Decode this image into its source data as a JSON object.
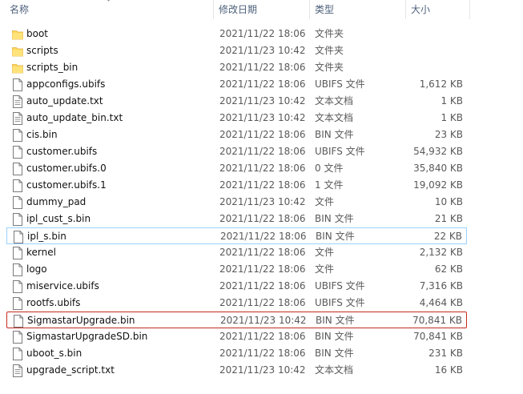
{
  "columns": {
    "name": "名称",
    "date": "修改日期",
    "type": "类型",
    "size": "大小"
  },
  "files": [
    {
      "name": "boot",
      "date": "2021/11/22 18:06",
      "type": "文件夹",
      "size": "",
      "icon": "folder-icon"
    },
    {
      "name": "scripts",
      "date": "2021/11/23 10:42",
      "type": "文件夹",
      "size": "",
      "icon": "folder-icon"
    },
    {
      "name": "scripts_bin",
      "date": "2021/11/22 18:06",
      "type": "文件夹",
      "size": "",
      "icon": "folder-icon"
    },
    {
      "name": "appconfigs.ubifs",
      "date": "2021/11/22 18:06",
      "type": "UBIFS 文件",
      "size": "1,612 KB",
      "icon": "file-icon"
    },
    {
      "name": "auto_update.txt",
      "date": "2021/11/23 10:42",
      "type": "文本文档",
      "size": "1 KB",
      "icon": "text-file-icon"
    },
    {
      "name": "auto_update_bin.txt",
      "date": "2021/11/23 10:42",
      "type": "文本文档",
      "size": "1 KB",
      "icon": "text-file-icon"
    },
    {
      "name": "cis.bin",
      "date": "2021/11/22 18:06",
      "type": "BIN 文件",
      "size": "23 KB",
      "icon": "file-icon"
    },
    {
      "name": "customer.ubifs",
      "date": "2021/11/22 18:06",
      "type": "UBIFS 文件",
      "size": "54,932 KB",
      "icon": "file-icon"
    },
    {
      "name": "customer.ubifs.0",
      "date": "2021/11/22 18:06",
      "type": "0 文件",
      "size": "35,840 KB",
      "icon": "file-icon"
    },
    {
      "name": "customer.ubifs.1",
      "date": "2021/11/22 18:06",
      "type": "1 文件",
      "size": "19,092 KB",
      "icon": "file-icon"
    },
    {
      "name": "dummy_pad",
      "date": "2021/11/23 10:42",
      "type": "文件",
      "size": "10 KB",
      "icon": "file-icon"
    },
    {
      "name": "ipl_cust_s.bin",
      "date": "2021/11/22 18:06",
      "type": "BIN 文件",
      "size": "21 KB",
      "icon": "file-icon"
    },
    {
      "name": "ipl_s.bin",
      "date": "2021/11/22 18:06",
      "type": "BIN 文件",
      "size": "22 KB",
      "icon": "file-icon",
      "focused": true
    },
    {
      "name": "kernel",
      "date": "2021/11/22 18:06",
      "type": "文件",
      "size": "2,132 KB",
      "icon": "file-icon"
    },
    {
      "name": "logo",
      "date": "2021/11/22 18:06",
      "type": "文件",
      "size": "62 KB",
      "icon": "file-icon"
    },
    {
      "name": "miservice.ubifs",
      "date": "2021/11/22 18:06",
      "type": "UBIFS 文件",
      "size": "7,316 KB",
      "icon": "file-icon"
    },
    {
      "name": "rootfs.ubifs",
      "date": "2021/11/22 18:06",
      "type": "UBIFS 文件",
      "size": "4,464 KB",
      "icon": "file-icon"
    },
    {
      "name": "SigmastarUpgrade.bin",
      "date": "2021/11/23 10:42",
      "type": "BIN 文件",
      "size": "70,841 KB",
      "icon": "file-icon",
      "marked": true
    },
    {
      "name": "SigmastarUpgradeSD.bin",
      "date": "2021/11/22 18:06",
      "type": "BIN 文件",
      "size": "70,841 KB",
      "icon": "file-icon"
    },
    {
      "name": "uboot_s.bin",
      "date": "2021/11/22 18:06",
      "type": "BIN 文件",
      "size": "231 KB",
      "icon": "file-icon"
    },
    {
      "name": "upgrade_script.txt",
      "date": "2021/11/23 10:42",
      "type": "文本文档",
      "size": "16 KB",
      "icon": "text-file-icon"
    }
  ],
  "colors": {
    "header_text": "#4c607a",
    "focus_border": "#99d1ff",
    "mark_border": "#c42b1c",
    "folder": "#ffd75e"
  }
}
